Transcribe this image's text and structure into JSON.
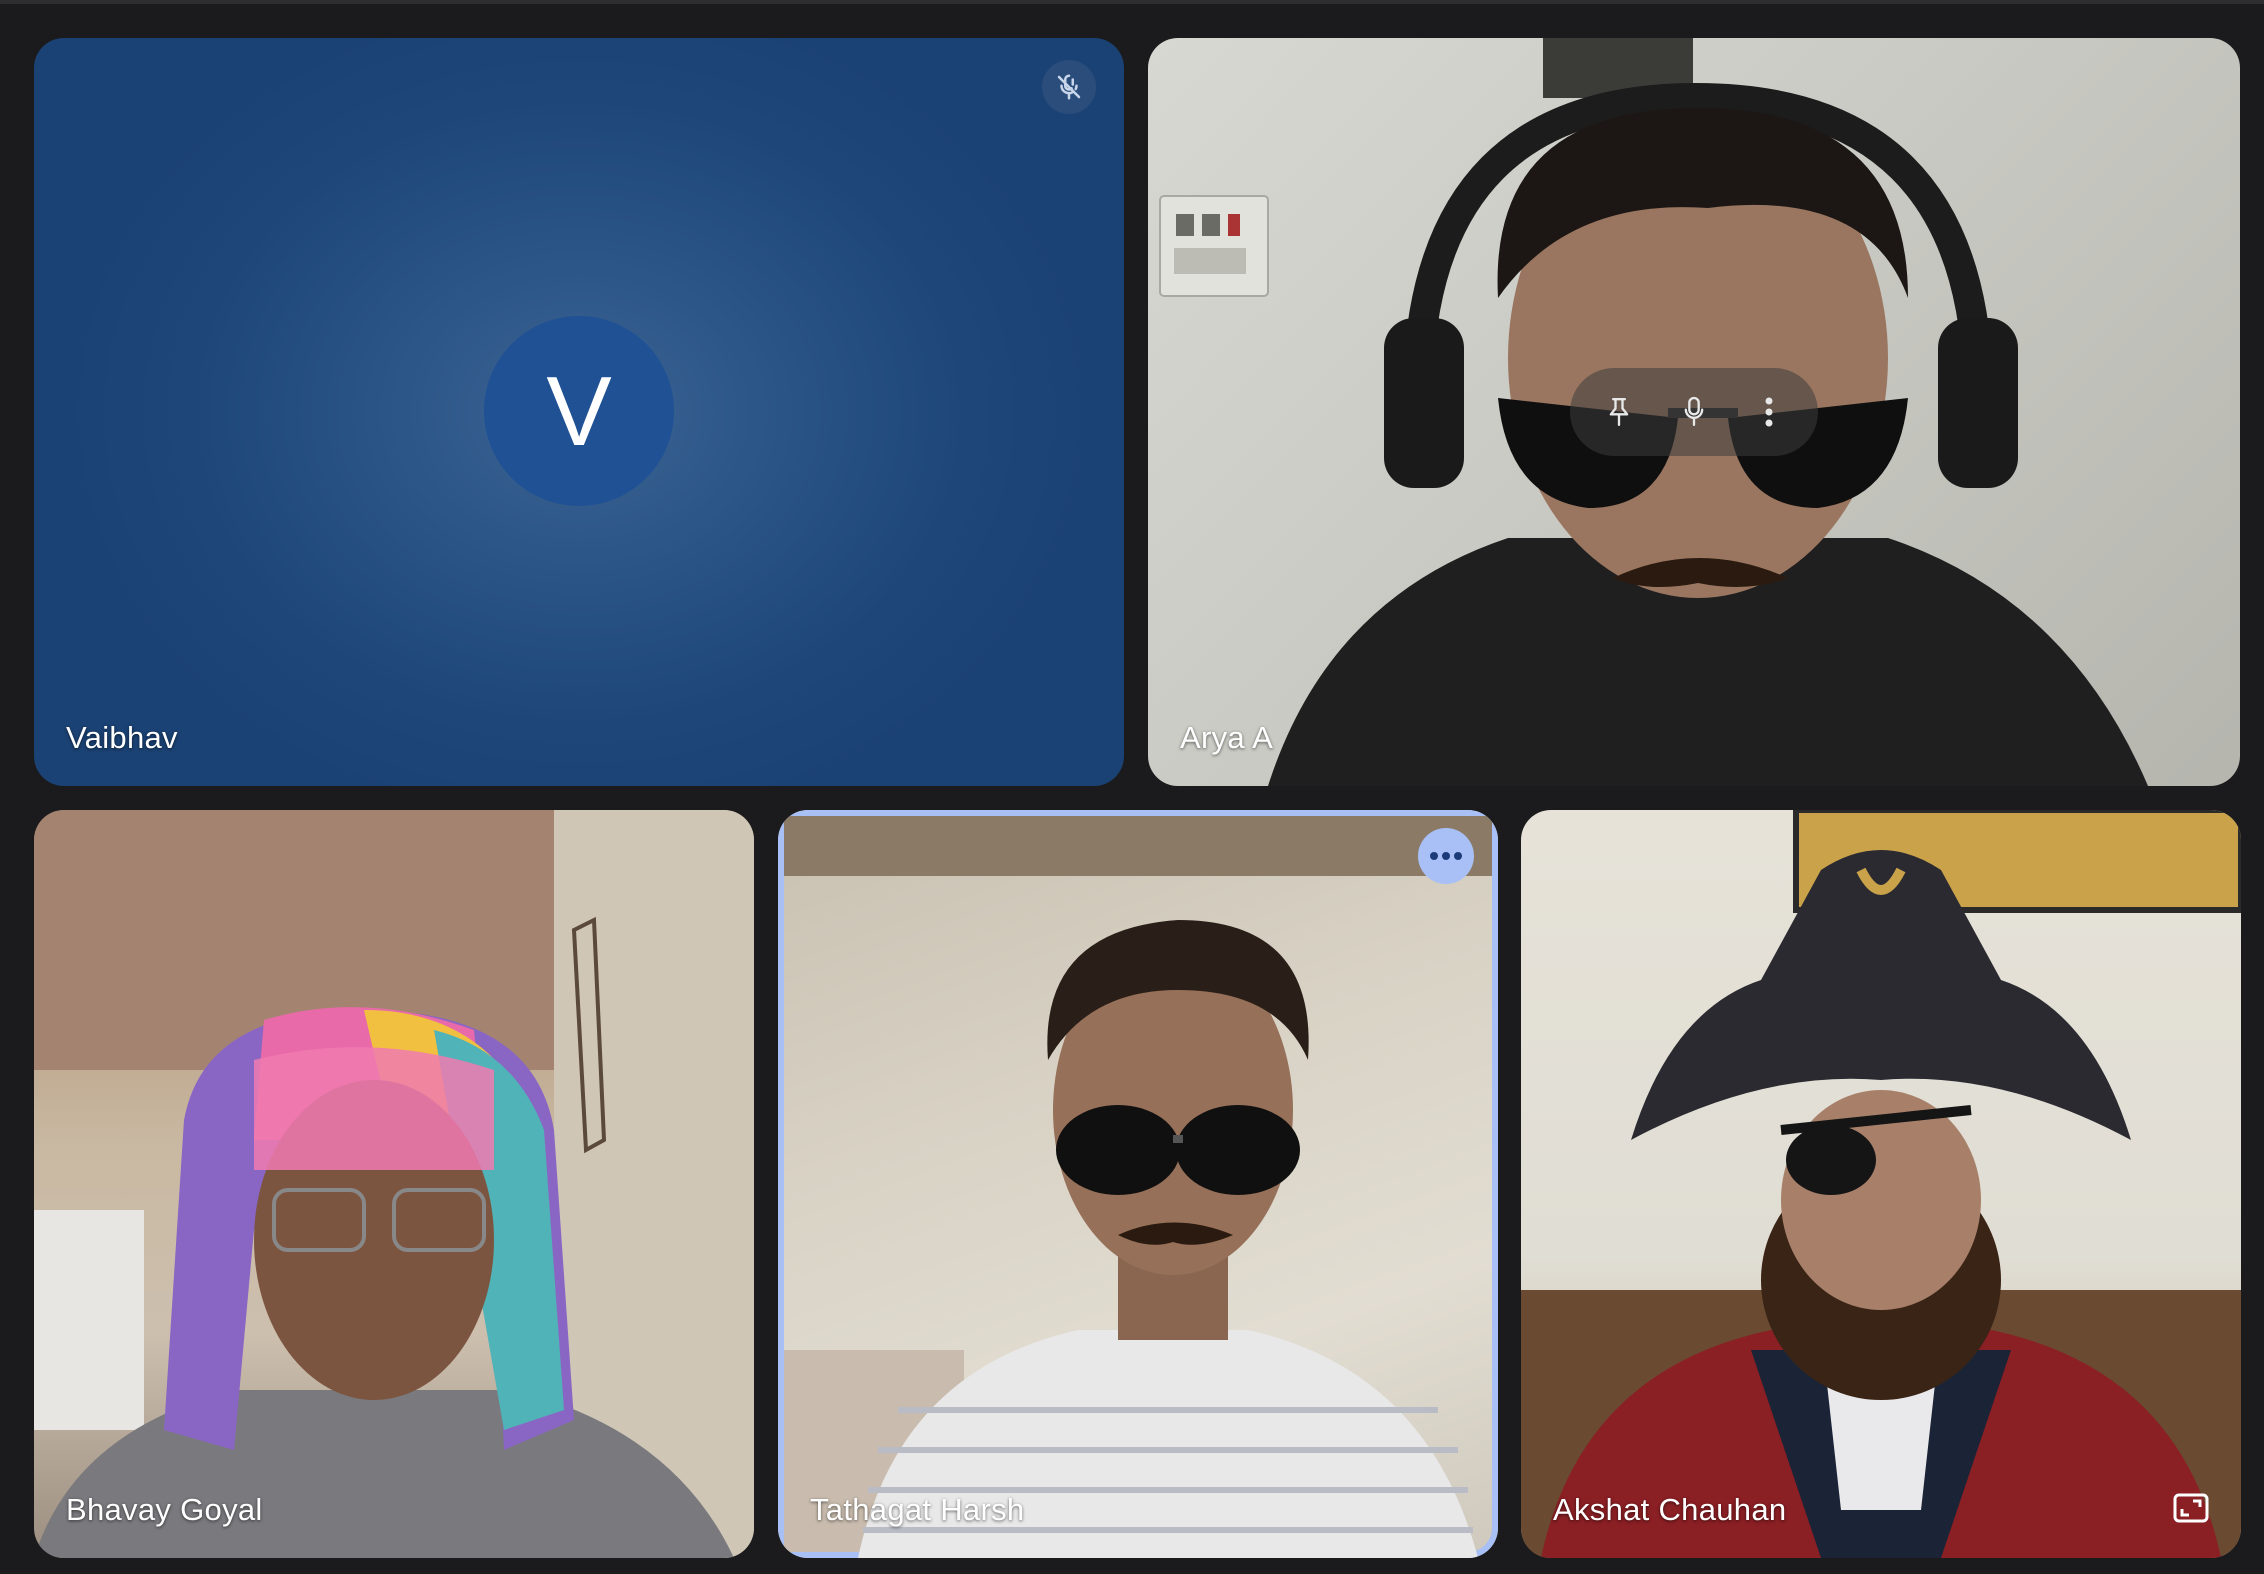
{
  "participants": {
    "vaibhav": {
      "name": "Vaibhav",
      "initial": "V",
      "muted": true
    },
    "arya": {
      "name": "Arya A"
    },
    "bhavay": {
      "name": "Bhavay Goyal"
    },
    "tathagat": {
      "name": "Tathagat Harsh",
      "active_speaker": true
    },
    "akshat": {
      "name": "Akshat Chauhan"
    }
  },
  "icons": {
    "mute": "mic-off-icon",
    "pin": "pin-icon",
    "mic": "mic-icon",
    "more": "more-vert-icon",
    "more_horiz": "more-horiz-icon",
    "expand": "expand-icon"
  },
  "colors": {
    "background": "#1b1b1d",
    "avatar_tile": "#1e4678",
    "avatar_circle": "#1f5194",
    "active_border": "#a8c0f5"
  }
}
